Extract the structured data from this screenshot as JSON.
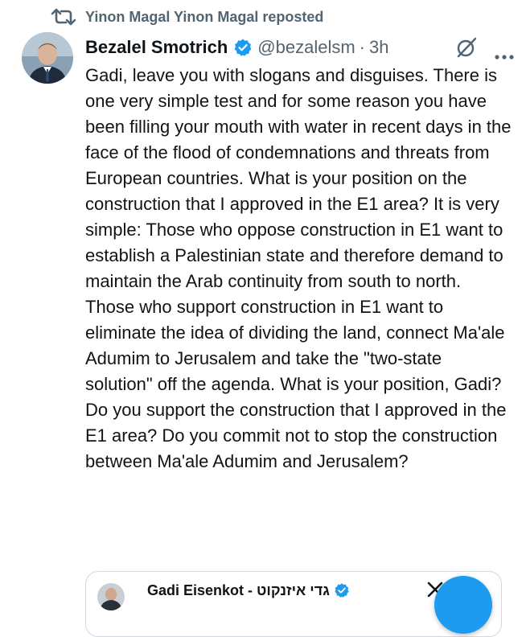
{
  "repost": {
    "text": "Yinon Magal Yinon Magal reposted"
  },
  "tweet": {
    "author_name": "Bezalel Smotrich",
    "handle": "@bezalelsm",
    "separator": "·",
    "time": "3h",
    "text": "Gadi, leave you with slogans and disguises. There is one very simple test and for some reason you have been filling your mouth with water in recent days in the face of the flood of condemnations and threats from European countries. What is your position on the construction that I approved in the E1 area? It is very simple: Those who oppose construction in E1 want to establish a Palestinian state and therefore demand to maintain the Arab continuity from south to north. Those who support construction in E1 want to eliminate the idea of dividing the land, connect Ma'ale Adumim to Jerusalem and take the \"two-state solution\" off the agenda. What is your position, Gadi? Do you support the construction that I approved in the E1 area? Do you commit not to stop the construction between Ma'ale Adumim and Jerusalem?"
  },
  "quoted": {
    "author_name": "Gadi Eisenkot - גדי איזנקוט"
  },
  "icons": {
    "repost": "repost-icon",
    "verified": "verified-badge-icon",
    "grok": "grok-icon",
    "more": "more-icon",
    "x_logo": "x-logo-icon"
  },
  "colors": {
    "accent": "#1d9bf0",
    "muted_text": "#536471",
    "text": "#0f1419",
    "border": "#cfd9de"
  }
}
